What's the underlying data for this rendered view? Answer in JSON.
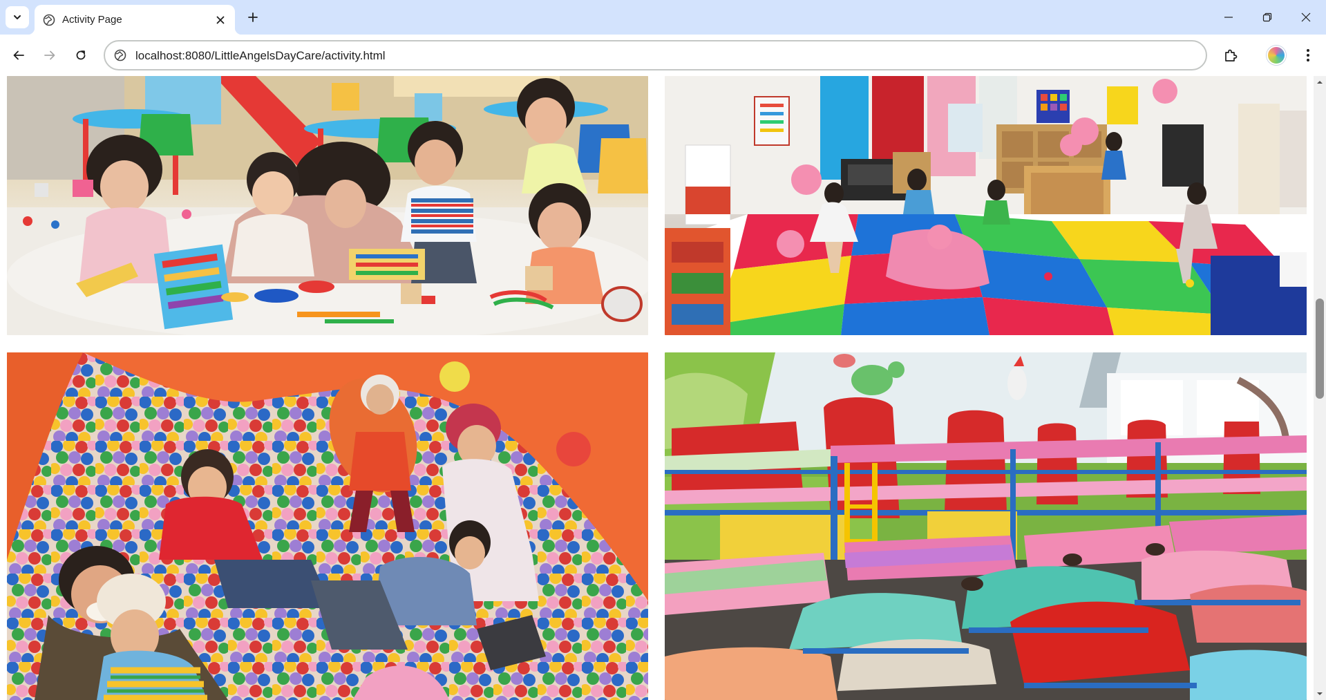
{
  "browser": {
    "tab": {
      "title": "Activity Page"
    },
    "address_bar": {
      "url": "localhost:8080/LittleAngelsDayCare/activity.html"
    },
    "icons": {
      "tab_search": "chevron-down-icon",
      "favicon": "globe-icon",
      "tab_close": "close-icon",
      "new_tab": "plus-icon",
      "minimize": "minimize-icon",
      "restore": "restore-icon",
      "close_window": "close-icon",
      "back": "arrow-left-icon",
      "forward": "arrow-right-icon",
      "reload": "reload-icon",
      "site_info": "site-info-icon",
      "extensions": "puzzle-icon",
      "profile": "avatar",
      "menu": "kebab-menu-icon"
    }
  },
  "gallery": {
    "images": [
      {
        "id": "classroom-play",
        "subject": "children playing with toys on a classroom rug"
      },
      {
        "id": "playroom-mats",
        "subject": "toddlers playing in a playroom with colorful foam mats"
      },
      {
        "id": "ball-pit",
        "subject": "children and a teacher lying in a colorful ball pit"
      },
      {
        "id": "nap-room",
        "subject": "nap room with bunk beds and children sleeping on cots"
      }
    ]
  },
  "colors": {
    "tabstrip_bg": "#d3e3fd",
    "mat_red": "#e8284d",
    "mat_blue": "#1e73d8",
    "mat_green": "#3cc653",
    "mat_yellow": "#f7d61c",
    "ball_pit_wall": "#f06a34",
    "bed_frame_red": "#d62a2a",
    "nap_room_wall_green": "#8bc34a"
  }
}
